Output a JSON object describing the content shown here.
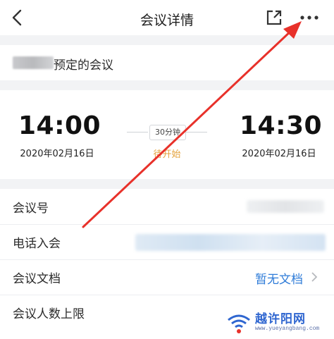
{
  "nav": {
    "title": "会议详情",
    "back_icon": "chevron-left-icon",
    "share_icon": "share-icon",
    "more_icon": "more-horizontal-icon"
  },
  "organizer": {
    "text": "预定的会议"
  },
  "schedule": {
    "start_time": "14:00",
    "start_date": "2020年02月16日",
    "end_time": "14:30",
    "end_date": "2020年02月16日",
    "duration": "30分钟",
    "status": "待开始",
    "status_color": "#e4a23c"
  },
  "details": {
    "rows": [
      {
        "label": "会议号",
        "value": ""
      },
      {
        "label": "电话入会",
        "value": ""
      },
      {
        "label": "会议文档",
        "value": "暂无文档"
      },
      {
        "label": "会议人数上限",
        "value": ""
      }
    ],
    "link_color": "#2f7cd8"
  },
  "watermark": {
    "brand": "越许阳网",
    "url": "www.yueyangbang.com"
  },
  "colors": {
    "accent": "#2f7cd8",
    "arrow": "#e8312a",
    "background": "#f2f3f5"
  }
}
